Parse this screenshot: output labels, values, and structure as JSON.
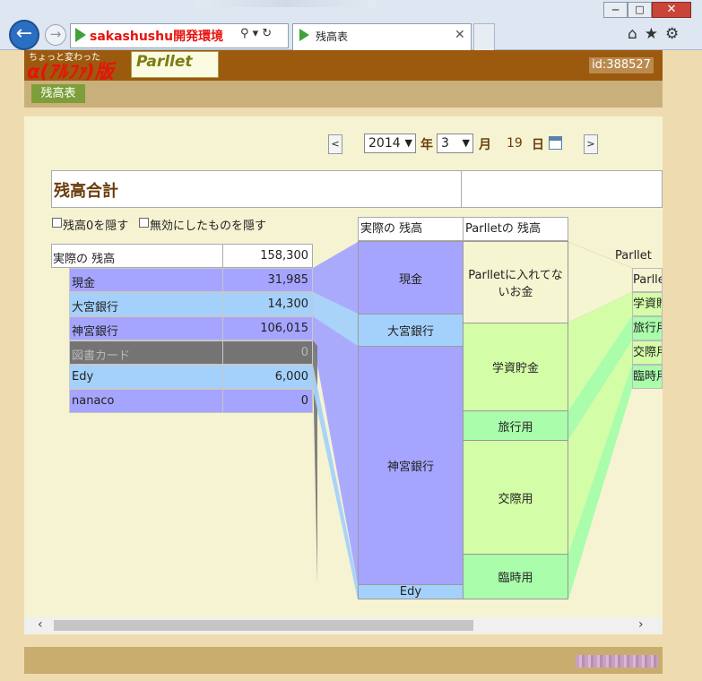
{
  "browser": {
    "address_text": "sakashushu開発環境",
    "tab_title": "残高表",
    "tool_icons": "⌂★⚙"
  },
  "page": {
    "brand_sub": "ちょっと変わった",
    "brand_main": "α(ｱﾙﾌｧ)版",
    "logo_text": "Parllet",
    "user_id": "id:388527",
    "nav_tab": "残高表"
  },
  "date": {
    "prev": "<",
    "next": ">",
    "year": "2014",
    "year_label": "年",
    "month": "3",
    "month_label": "月",
    "day": "19",
    "day_label": "日"
  },
  "summary": {
    "title": "残高合計",
    "hide_zero": "残高0を隠す",
    "hide_disabled": "無効にしたものを隠す"
  },
  "real_balance": {
    "header_label": "実際の 残高",
    "total": "158,300",
    "rows": [
      {
        "name": "現金",
        "value": "31,985",
        "color": "#a5a5ff"
      },
      {
        "name": "大宮銀行",
        "value": "14,300",
        "color": "#a4d1fb"
      },
      {
        "name": "神宮銀行",
        "value": "106,015",
        "color": "#a5a5ff"
      },
      {
        "name": "図書カード",
        "value": "0",
        "color": "#747474"
      },
      {
        "name": "Edy",
        "value": "6,000",
        "color": "#a4d1fb"
      },
      {
        "name": "nanaco",
        "value": "0",
        "color": "#a5a5ff"
      }
    ]
  },
  "columns": {
    "real_header": "実際の 残高",
    "parllet_header": "Parlletの 残高",
    "parllet2_header": "Parlletの",
    "real_blocks": [
      "現金",
      "大宮銀行",
      "神宮銀行",
      "Edy"
    ],
    "parllet_blocks": [
      "Parlletに入れてないお金",
      "学資貯金",
      "旅行用",
      "交際用",
      "臨時用"
    ],
    "parllet2_rows": [
      "Parlle",
      "学資貯",
      "旅行用",
      "交際用",
      "臨時用"
    ]
  },
  "colors": {
    "blue": "#a5a5ff",
    "lightblue": "#a4d1fb",
    "cream": "#f5f5d2",
    "lime": "#d4fda7",
    "green": "#a9fdab",
    "header_brown": "#9b5a0e"
  }
}
